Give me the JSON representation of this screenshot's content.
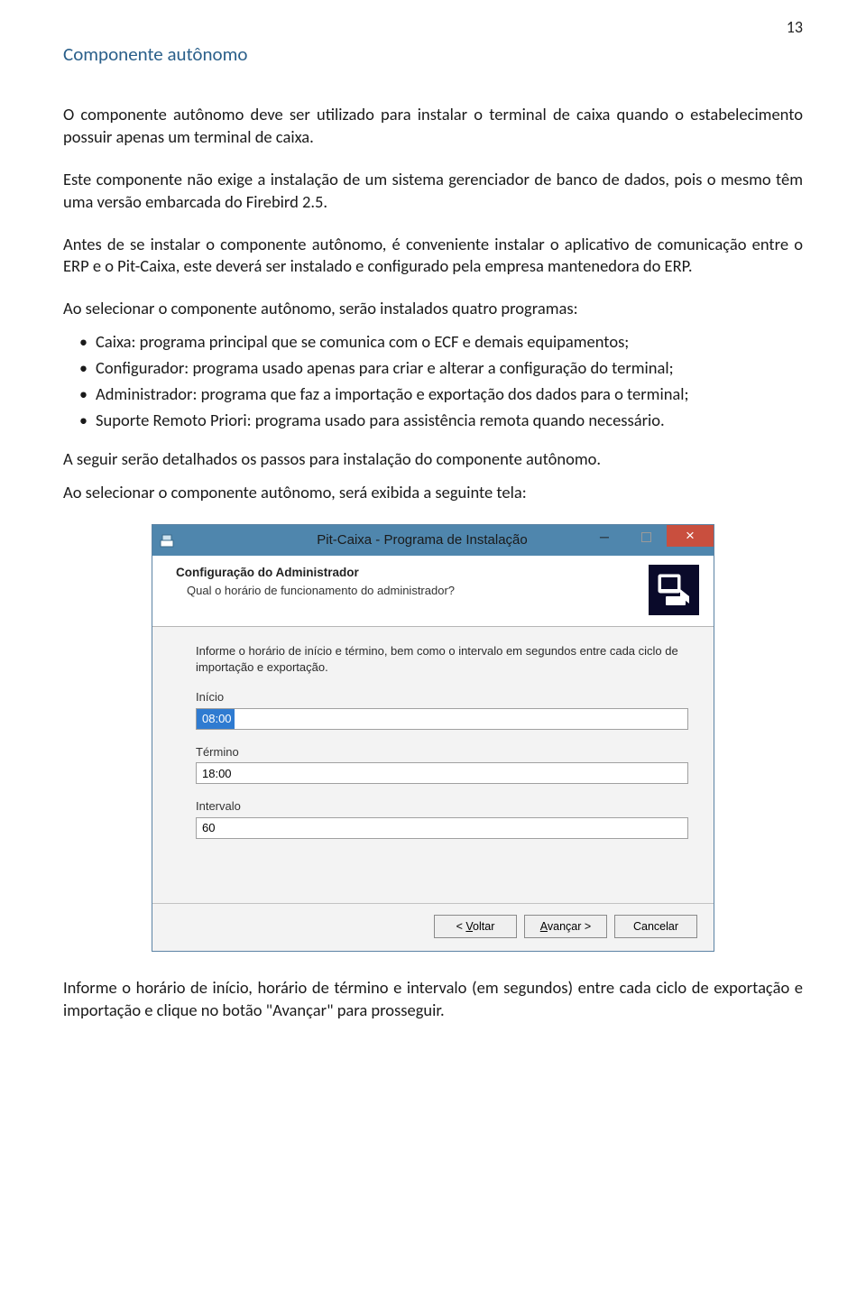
{
  "page": {
    "number": "13"
  },
  "heading": "Componente autônomo",
  "paragraphs": {
    "p1": "O componente autônomo deve ser utilizado para instalar o terminal de caixa quando o estabelecimento possuir apenas um terminal de caixa.",
    "p2": "Este componente não exige a instalação de um sistema gerenciador de banco de dados, pois o mesmo têm uma versão embarcada do Firebird 2.5.",
    "p3": "Antes de se instalar o componente autônomo, é conveniente instalar o aplicativo de comunicação entre o ERP e o Pit-Caixa, este deverá ser instalado e configurado pela empresa mantenedora do ERP.",
    "p4": "Ao selecionar o componente autônomo, serão instalados quatro programas:",
    "p5": "A seguir serão detalhados os passos para instalação do componente autônomo.",
    "p6": "Ao selecionar o componente autônomo, será exibida a seguinte tela:",
    "p7": "Informe o horário de início, horário de término e intervalo (em segundos) entre cada ciclo de exportação e importação e clique no botão \"Avançar\" para prosseguir."
  },
  "bullets": [
    "Caixa: programa principal que se comunica com o ECF e demais equipamentos;",
    "Configurador: programa usado apenas para criar e alterar a configuração do terminal;",
    "Administrador: programa que faz a importação e exportação dos dados para o terminal;",
    "Suporte Remoto Priori: programa usado para assistência remota quando necessário."
  ],
  "installer": {
    "title": "Pit-Caixa - Programa de Instalação",
    "header_title": "Configuração do Administrador",
    "header_sub": "Qual o horário de funcionamento do administrador?",
    "instruction": "Informe o horário de início e término, bem como o intervalo em segundos entre cada ciclo de importação e exportação.",
    "fields": {
      "inicio_label": "Início",
      "inicio_value": "08:00",
      "termino_label": "Término",
      "termino_value": "18:00",
      "intervalo_label": "Intervalo",
      "intervalo_value": "60"
    },
    "buttons": {
      "back_prefix": "< ",
      "back_u": "V",
      "back_rest": "oltar",
      "next_u": "A",
      "next_rest": "vançar >",
      "cancel": "Cancelar"
    }
  }
}
